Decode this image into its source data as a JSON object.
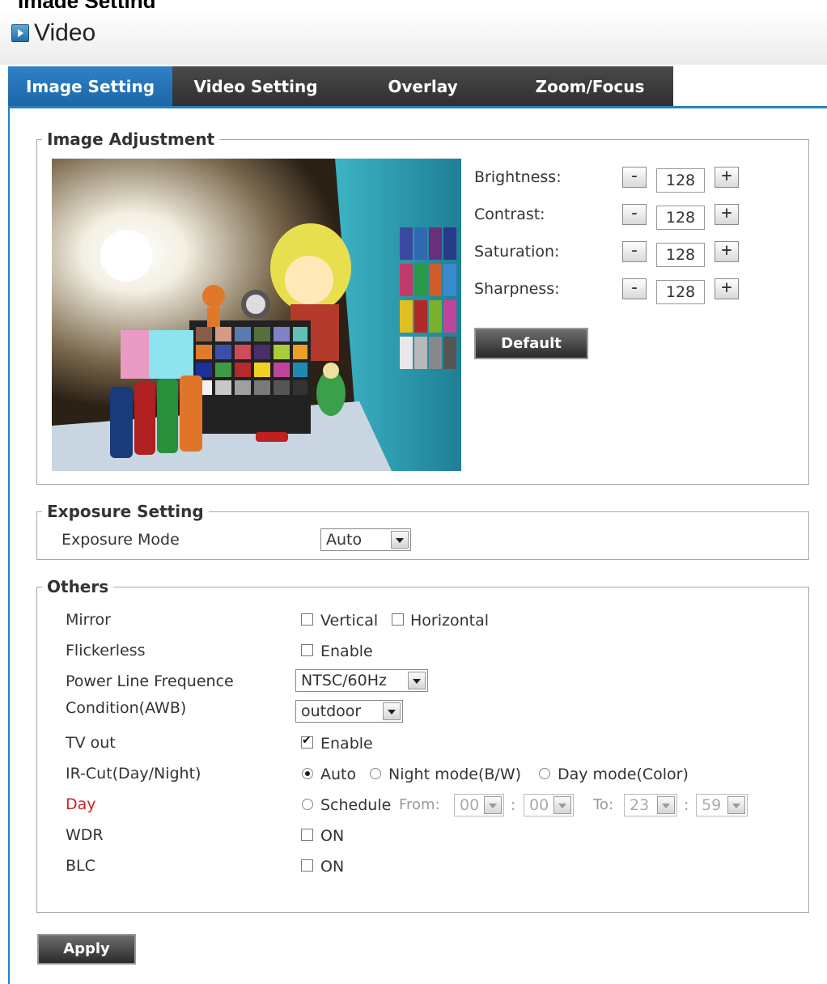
{
  "doc_heading": "Image Setting",
  "page": {
    "title": "Video"
  },
  "tabs": [
    {
      "label": "Image Setting",
      "active": true
    },
    {
      "label": "Video Setting",
      "active": false
    },
    {
      "label": "Overlay",
      "active": false
    },
    {
      "label": "Zoom/Focus",
      "active": false
    }
  ],
  "image_adjustment": {
    "legend": "Image Adjustment",
    "controls": [
      {
        "label": "Brightness:",
        "value": "128"
      },
      {
        "label": "Contrast:",
        "value": "128"
      },
      {
        "label": "Saturation:",
        "value": "128"
      },
      {
        "label": "Sharpness:",
        "value": "128"
      }
    ],
    "minus": "-",
    "plus": "+",
    "default_label": "Default"
  },
  "exposure": {
    "legend": "Exposure Setting",
    "mode_label": "Exposure Mode",
    "mode_value": "Auto"
  },
  "others": {
    "legend": "Others",
    "mirror": {
      "label": "Mirror",
      "vertical": "Vertical",
      "horizontal": "Horizontal",
      "vertical_checked": false,
      "horizontal_checked": false
    },
    "flickerless": {
      "label": "Flickerless",
      "option": "Enable",
      "checked": false
    },
    "power_line": {
      "label": "Power Line Frequence",
      "value": "NTSC/60Hz"
    },
    "condition": {
      "label": "Condition(AWB)",
      "value": "outdoor"
    },
    "tv_out": {
      "label": "TV out",
      "option": "Enable",
      "checked": true
    },
    "ir_cut": {
      "label": "IR-Cut(Day/Night)",
      "auto": "Auto",
      "night": "Night mode(B/W)",
      "day": "Day mode(Color)",
      "selected": "Auto"
    },
    "day": {
      "label": "Day",
      "schedule": "Schedule",
      "from": "From:",
      "to": "To:",
      "from_h": "00",
      "from_m": "00",
      "to_h": "23",
      "to_m": "59",
      "sep": ":"
    },
    "wdr": {
      "label": "WDR",
      "option": "ON",
      "checked": false
    },
    "blc": {
      "label": "BLC",
      "option": "ON",
      "checked": false
    }
  },
  "apply_label": "Apply",
  "colors": {
    "accent": "#2a7fbf",
    "tab_bg": "#3a3a3a",
    "day_label": "#cc2222"
  }
}
